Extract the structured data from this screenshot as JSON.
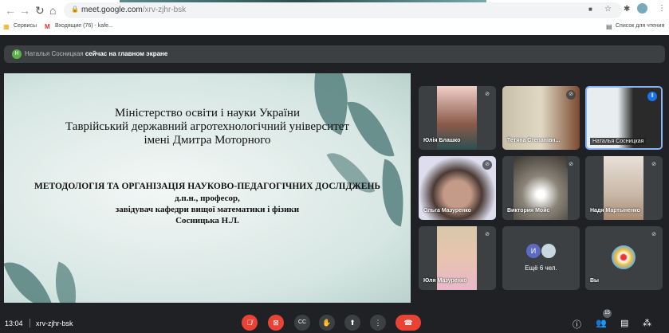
{
  "browser": {
    "url_host": "meet.google.com",
    "url_path": "/xrv-zjhr-bsk",
    "bookmarks": [
      {
        "icon": "apps-grid-icon",
        "label": "Сервисы"
      },
      {
        "icon": "gmail-icon",
        "label": "Входящие (76) - kafe..."
      }
    ],
    "reading_list": "Список для чтения"
  },
  "banner": {
    "avatar": "Н",
    "name": "Наталья Сосницкая",
    "text": "сейчас на главном экране"
  },
  "slide": {
    "line1": "Міністерство освіти і науки України",
    "line2": "Таврійський державний агротехнологічний університет",
    "line3": "імені Дмитра Моторного",
    "title": "МЕТОДОЛОГІЯ ТА ОРГАНІЗАЦІЯ НАУКОВО-ПЕДАГОГІЧНИХ ДОСЛІДЖЕНЬ",
    "degree": "д.п.н., професор,",
    "position": "завідувач кафедри вищої математики і фізики",
    "author": "Сосницька Н.Л."
  },
  "participants": [
    {
      "name": "Юлія Блашко",
      "muted": true
    },
    {
      "name": "Тетяна Степанівн...",
      "muted": true
    },
    {
      "name": "Наталья Сосницкая",
      "speaking": true
    },
    {
      "name": "Ольга Мазуренко",
      "muted": true
    },
    {
      "name": "Виктория Мойс",
      "muted": true
    },
    {
      "name": "Надя Мартыненко",
      "muted": true
    },
    {
      "name": "Юля Мазуренко",
      "muted": true
    },
    {
      "name": "Ещё 6 чел.",
      "avatar": "И"
    },
    {
      "name": "Вы",
      "muted": true
    }
  ],
  "footer": {
    "time": "13:04",
    "meeting_code": "xrv-zjhr-bsk",
    "people_count": "15"
  },
  "colors": {
    "end_call": "#ea4335",
    "banner_avatar": "#5bb04a",
    "speaking_border": "#8ab4f8"
  }
}
